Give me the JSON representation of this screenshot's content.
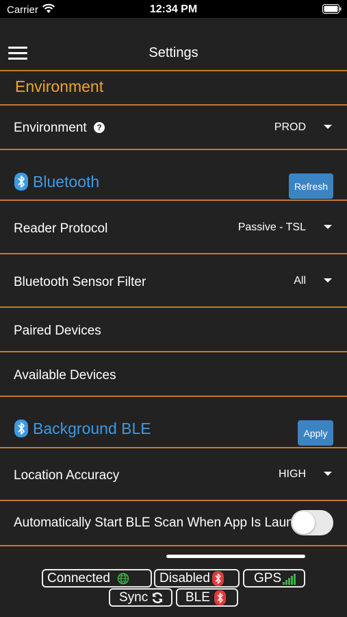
{
  "status_bar": {
    "carrier": "Carrier",
    "time": "12:34 PM"
  },
  "nav": {
    "title": "Settings",
    "menu_icon": "hamburger-icon"
  },
  "environment_section": {
    "title": "Environment",
    "title_color": "#f0a42c",
    "row": {
      "label": "Environment",
      "value": "PROD",
      "help_glyph": "?"
    }
  },
  "bluetooth_section": {
    "title": "Bluetooth",
    "title_color": "#3d9ae5",
    "refresh_label": "Refresh",
    "reader_protocol": {
      "label": "Reader Protocol",
      "value": "Passive - TSL"
    },
    "sensor_filter": {
      "label": "Bluetooth Sensor Filter",
      "value": "All"
    },
    "paired_devices": {
      "label": "Paired Devices"
    },
    "available_devices": {
      "label": "Available Devices"
    }
  },
  "background_ble_section": {
    "title": "Background BLE",
    "apply_label": "Apply",
    "location_accuracy": {
      "label": "Location Accuracy",
      "value": "HIGH"
    },
    "auto_start": {
      "label": "Automatically Start BLE Scan When App Is Launched",
      "enabled": false
    }
  },
  "status_pills": {
    "connected": {
      "label": "Connected",
      "icon": "globe-icon",
      "color": "#3cb043"
    },
    "disabled": {
      "label": "Disabled",
      "icon": "bluetooth-icon",
      "color": "#e03a3a"
    },
    "gps": {
      "label": "GPS",
      "icon": "signal-bars-icon",
      "color": "#3cb043"
    },
    "sync": {
      "label": "Sync",
      "icon": "sync-icon"
    },
    "ble": {
      "label": "BLE",
      "icon": "bluetooth-icon",
      "color": "#e03a3a"
    }
  },
  "colors": {
    "accent_divider": "#c8782a",
    "button_blue": "#3b84c4",
    "background": "#222222"
  }
}
